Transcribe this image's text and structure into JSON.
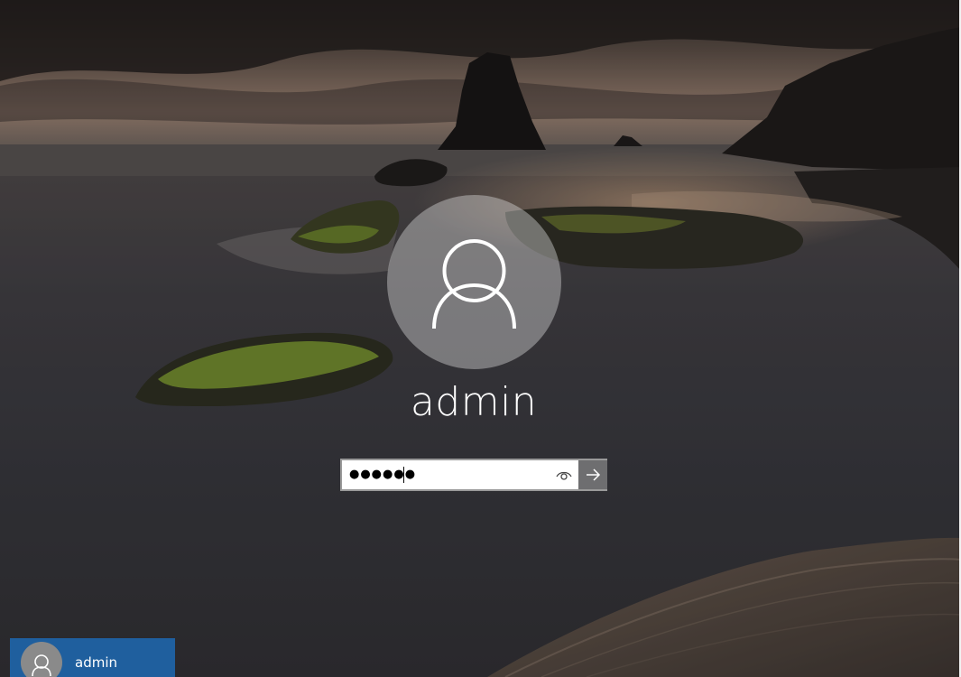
{
  "login": {
    "username": "admin",
    "password_masked": "●●●●●●"
  },
  "user_list": [
    {
      "name": "admin",
      "selected": true
    }
  ],
  "icons": {
    "avatar": "user-silhouette-icon",
    "reveal": "eye-icon",
    "submit": "arrow-right-icon"
  },
  "colors": {
    "selected_user_tile": "#1f5f9e",
    "submit_button": "#6e6e70",
    "password_border": "#9a9a9a"
  }
}
